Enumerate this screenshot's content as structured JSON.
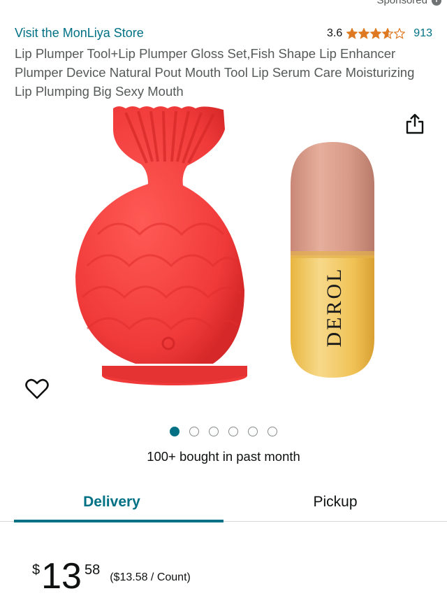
{
  "sponsored": {
    "label": "Sponsored",
    "info_icon": "i"
  },
  "store": {
    "link_text": "Visit the MonLiya Store"
  },
  "rating": {
    "score": "3.6",
    "stars_filled": 3.6,
    "review_count": "913",
    "star_color": "#de7921"
  },
  "product": {
    "title": "Lip Plumper Tool+Lip Plumper Gloss Set,Fish Shape Lip Enhancer Plumper Device Natural Pout Mouth Tool Lip Serum Care Moisturizing Lip Plumping Big Sexy Mouth",
    "image_brand_text": "DEROL",
    "tool_color": "#f03a3a",
    "cap_color": "#d89a88",
    "gloss_color": "#f0c255"
  },
  "carousel": {
    "total": 6,
    "active_index": 0
  },
  "social_proof": "100+ bought in past month",
  "tabs": [
    {
      "label": "Delivery",
      "active": true
    },
    {
      "label": "Pickup",
      "active": false
    }
  ],
  "price": {
    "currency": "$",
    "whole": "13",
    "fraction": "58",
    "unit_price": "($13.58 / Count)"
  },
  "colors": {
    "link": "#007185",
    "accent": "#007185",
    "text": "#0f1111",
    "muted": "#565959"
  },
  "icons": {
    "share": "share-icon",
    "wishlist": "heart-icon",
    "star": "star-icon"
  }
}
